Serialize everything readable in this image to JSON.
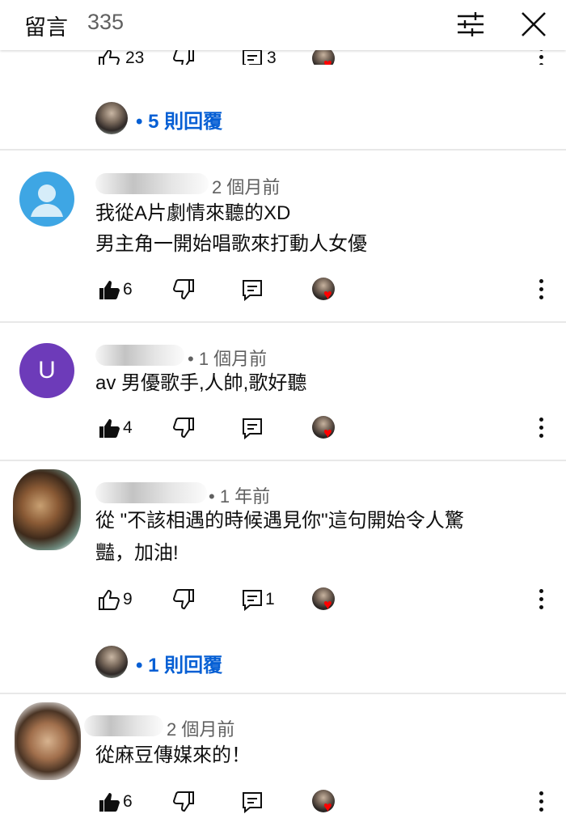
{
  "header": {
    "title": "留言",
    "count": "335"
  },
  "partial": {
    "likes": "23",
    "replies": "3"
  },
  "reply_links": [
    "• 5 則回覆",
    "• 1 則回覆"
  ],
  "comments": [
    {
      "time": "2 個月前",
      "lines": [
        "我從A片劇情來聽的XD",
        "男主角一開始唱歌來打動人女優"
      ],
      "likes": "6",
      "replies": "",
      "avatar_letter": ""
    },
    {
      "time": "• 1 個月前",
      "lines": [
        "av 男優歌手,人帥,歌好聽"
      ],
      "likes": "4",
      "replies": "",
      "avatar_letter": "U"
    },
    {
      "time": "• 1 年前",
      "lines": [
        "從 \"不該相遇的時候遇見你\"這句開始令人驚",
        "豔，加油!"
      ],
      "likes": "9",
      "replies": "1",
      "avatar_letter": ""
    },
    {
      "time": "2 個月前",
      "lines": [
        "從麻豆傳媒來的！"
      ],
      "likes": "6",
      "replies": "",
      "avatar_letter": ""
    }
  ],
  "colors": {
    "link": "#065fd4",
    "heart": "#ff0000",
    "secondary": "#606060"
  }
}
